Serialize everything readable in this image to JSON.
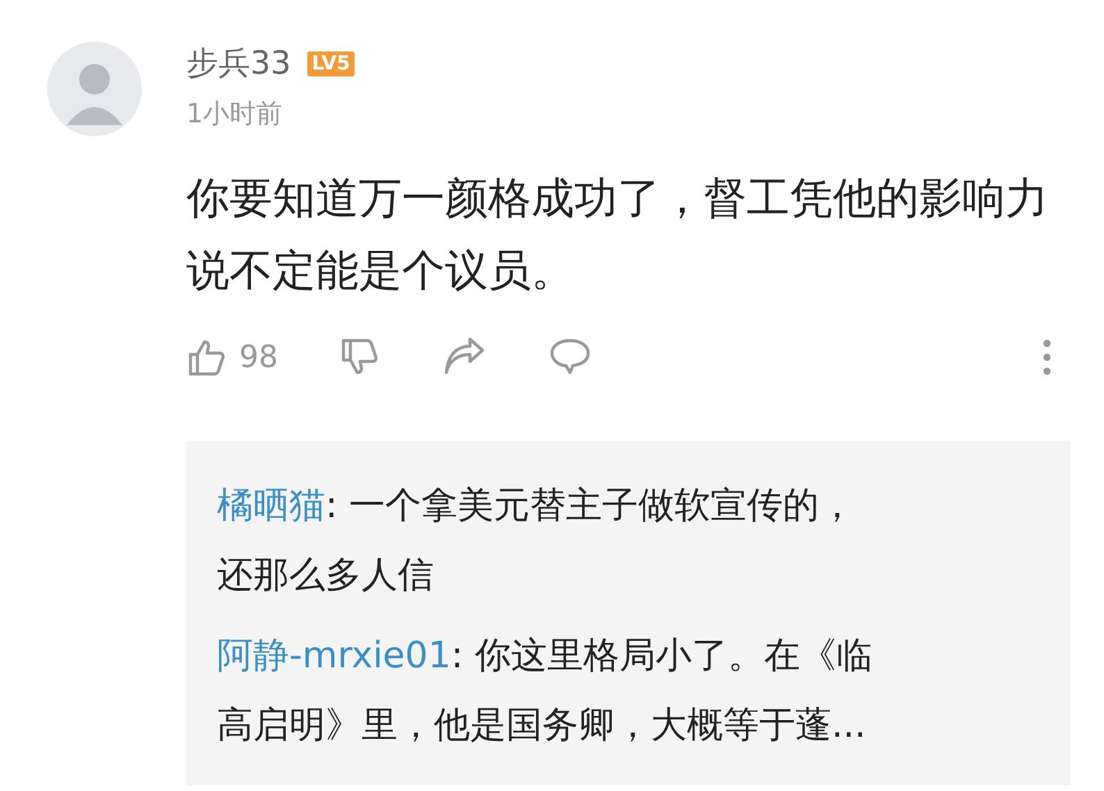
{
  "comment": {
    "author": "步兵33",
    "level_badge": "LV5",
    "time": "1小时前",
    "text": "你要知道万一颜格成功了，督工凭他的影响力说不定能是个议员。",
    "likes": "98"
  },
  "replies": [
    {
      "author": "橘晒猫",
      "text": ": 一个拿美元替主子做软宣传的，还那么多人信"
    },
    {
      "author": "阿静-mrxie01",
      "text": ": 你这里格局小了。在《临高启明》里，他是国务卿，大概等于蓬..."
    }
  ]
}
